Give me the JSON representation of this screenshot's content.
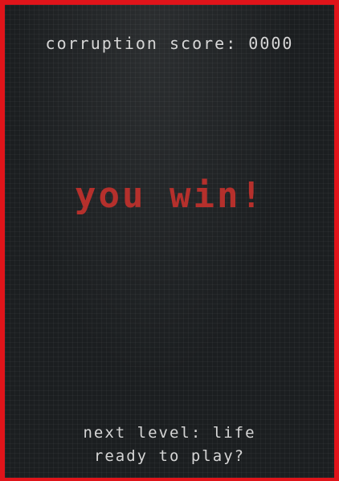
{
  "hud": {
    "score_text": "corruption score: 0000"
  },
  "result": {
    "headline": "you win!"
  },
  "footer": {
    "next_level": "next level: life",
    "prompt": "ready to play?"
  },
  "colors": {
    "border": "#e0141a",
    "background": "#1b1e20",
    "headline": "#b5302c",
    "text": "#d6d6d6"
  }
}
